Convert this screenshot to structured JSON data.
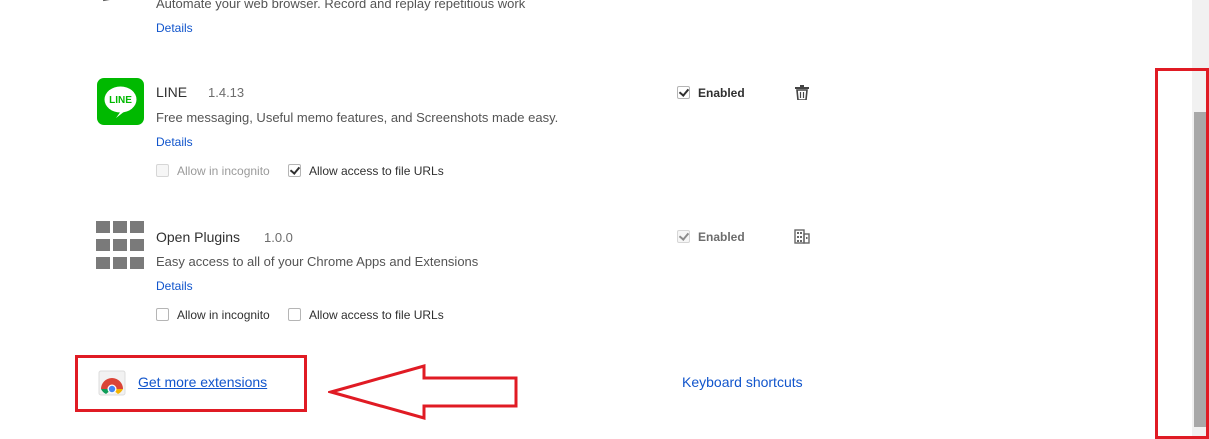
{
  "extensions": [
    {
      "description": "Automate your web browser. Record and replay repetitious work",
      "details_label": "Details"
    },
    {
      "name": "LINE",
      "version": "1.4.13",
      "description": "Free messaging, Useful memo features, and Screenshots made easy.",
      "details_label": "Details",
      "enabled_label": "Enabled",
      "enabled": true,
      "icon_text": "LINE",
      "allow_incognito_label": "Allow in incognito",
      "allow_incognito": false,
      "allow_file_urls_label": "Allow access to file URLs",
      "allow_file_urls": true
    },
    {
      "name": "Open Plugins",
      "version": "1.0.0",
      "description": "Easy access to all of your Chrome Apps and Extensions",
      "details_label": "Details",
      "enabled_label": "Enabled",
      "enabled": true,
      "allow_incognito_label": "Allow in incognito",
      "allow_incognito": false,
      "allow_file_urls_label": "Allow access to file URLs",
      "allow_file_urls": false
    }
  ],
  "footer": {
    "get_more_label": "Get more extensions",
    "keyboard_shortcuts_label": "Keyboard shortcuts"
  },
  "colors": {
    "annotation_red": "#e01b24",
    "link_blue": "#1155cc",
    "line_green": "#00b900"
  }
}
